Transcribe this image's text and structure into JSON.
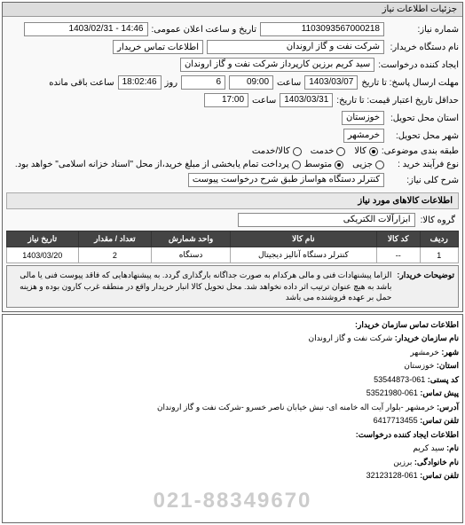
{
  "panel_title": "جزئیات اطلاعات نیاز",
  "fields": {
    "request_no_label": "شماره نیاز:",
    "request_no": "1103093567000218",
    "announce_date_label": "تاریخ و ساعت اعلان عمومی:",
    "announce_date": "14:46 - 1403/02/31",
    "buyer_org_label": "نام دستگاه خریدار:",
    "buyer_org": "شرکت نفت و گاز اروندان",
    "buyer_contact_btn": "اطلاعات تماس خریدار",
    "creator_label": "ایجاد کننده درخواست:",
    "creator": "سید کریم برزین کارپرداز شرکت نفت و گاز اروندان",
    "deadline_send_label": "مهلت ارسال پاسخ: تا تاریخ",
    "deadline_send_date": "1403/03/07",
    "time_label": "ساعت",
    "deadline_send_time": "09:00",
    "day_label": "روز",
    "days_remaining": "6",
    "time_remaining_label": "ساعت باقی مانده",
    "time_remaining": "18:02:46",
    "validity_label": "حداقل تاریخ اعتبار قیمت: تا تاریخ:",
    "validity_date": "1403/03/31",
    "validity_time": "17:00",
    "delivery_province_label": "استان محل تحویل:",
    "delivery_province": "خوزستان",
    "delivery_city_label": "شهر محل تحویل:",
    "delivery_city": "خرمشهر",
    "grouping_label": "طبقه بندی موضوعی:",
    "grouping_opts": {
      "goods": "کالا",
      "service": "خدمت",
      "both": "کالا/خدمت"
    },
    "purchase_type_label": "نوع فرآیند خرید :",
    "purchase_type_opts": {
      "small": "جزیی",
      "medium": "متوسط"
    },
    "purchase_note": "پرداخت تمام یابخشی از مبلغ خرید،از محل \"اسناد خزانه اسلامی\" خواهد بود.",
    "general_desc_label": "شرح کلی نیاز:",
    "general_desc": "کنترلر دستگاه هواساز طبق شرح درخواست پیوست",
    "items_section_title": "اطلاعات کالاهای مورد نیاز",
    "goods_group_label": "گروه کالا:",
    "goods_group": "ابزارآلات الکتریکی"
  },
  "table": {
    "headers": [
      "ردیف",
      "کد کالا",
      "نام کالا",
      "واحد شمارش",
      "تعداد / مقدار",
      "تاریخ نیاز"
    ],
    "rows": [
      [
        "1",
        "--",
        "کنترلر دستگاه آنالیز دیجیتال",
        "دستگاه",
        "2",
        "1403/03/20"
      ]
    ]
  },
  "notes": {
    "label": "توضیحات خریدار:",
    "text": "الزاما پیشنهادات فنی و مالی هرکدام به صورت جداگانه بارگذاری گردد. به پیشنهادهایی که فاقد پیوست فنی یا مالی باشد به هیچ عنوان ترتیب اثر داده نخواهد شد. محل تحویل کالا انبار خریدار واقع در منطقه غرب کارون بوده و هزینه حمل بر عهده فروشنده می باشد"
  },
  "contact": {
    "title": "اطلاعات تماس سازمان خریدار:",
    "org_name_label": "نام سازمان خریدار:",
    "org_name": "شرکت نفت و گاز اروندان",
    "city_label": "شهر:",
    "city": "خرمشهر",
    "province_label": "استان:",
    "province": "خوزستان",
    "postal_label": "کد پستی:",
    "postal": "061-53544873",
    "phone_label": "پیش تماس:",
    "phone": "061-53521980",
    "address_label": "آدرس:",
    "address": "خرمشهر -بلوار آیت اله خامنه ای- نبش خیابان ناصر خسرو -شرکت نفت و گاز اروندان",
    "fax_label": "تلفن تماس:",
    "fax": "6417713455",
    "creator_section": "اطلاعات ایجاد کننده درخواست:",
    "name_label": "نام:",
    "name": "سید کریم",
    "lastname_label": "نام خانوادگی:",
    "lastname": "برزین",
    "creator_phone_label": "تلفن تماس:",
    "creator_phone": "061-32123128",
    "big_phone": "021-88349670"
  }
}
